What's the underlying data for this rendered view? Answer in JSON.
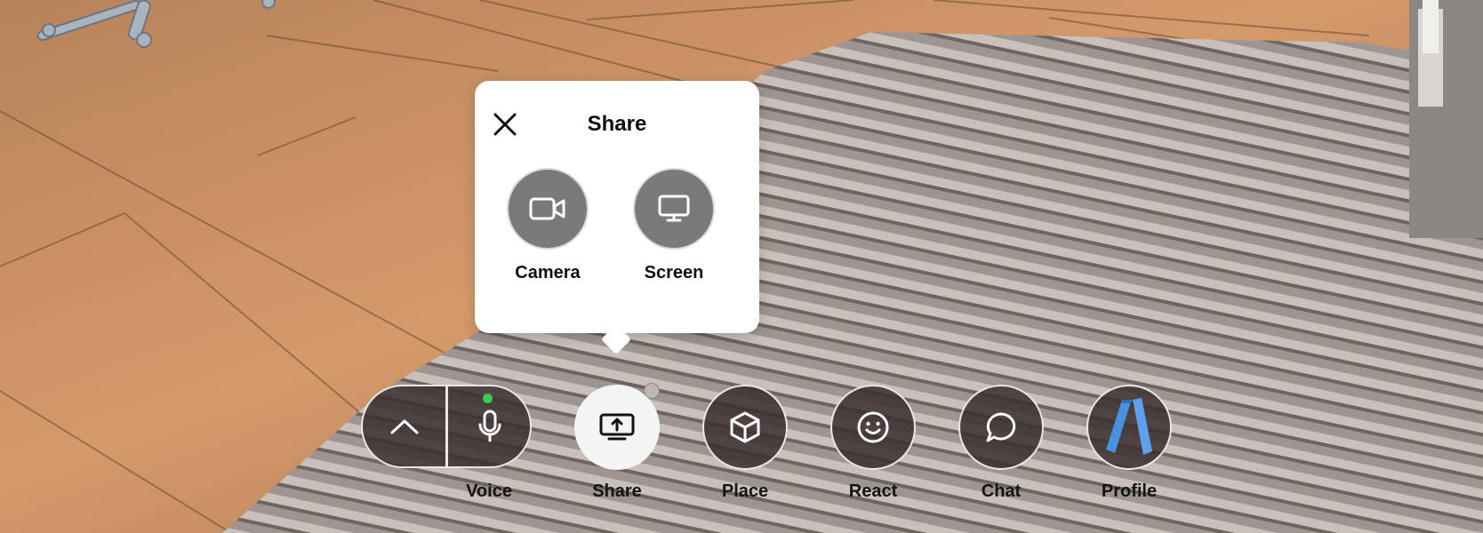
{
  "popover": {
    "title": "Share",
    "close_icon": "close-icon",
    "options": [
      {
        "label": "Camera",
        "icon": "video-camera-icon"
      },
      {
        "label": "Screen",
        "icon": "monitor-icon"
      }
    ]
  },
  "toolbar": {
    "expand_icon": "chevron-up-icon",
    "mic_icon": "microphone-icon",
    "mic_status_color": "#3ecb52",
    "items": [
      {
        "label": "Voice",
        "icon": "microphone-icon"
      },
      {
        "label": "Share",
        "icon": "screen-share-icon",
        "active": true
      },
      {
        "label": "Place",
        "icon": "cube-icon"
      },
      {
        "label": "React",
        "icon": "smiley-icon"
      },
      {
        "label": "Chat",
        "icon": "chat-bubble-icon"
      },
      {
        "label": "Profile",
        "icon": "avatar-icon"
      }
    ]
  },
  "colors": {
    "popover_bg": "#ffffff",
    "option_circle": "#7a7a7a",
    "button_bg": "#3a302e",
    "active_button_bg": "#f4f4f4",
    "profile_avatar": "#4a90e2"
  }
}
